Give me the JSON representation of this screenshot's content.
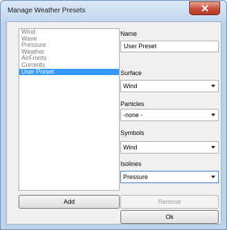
{
  "window": {
    "title": "Manage Weather Presets"
  },
  "presets": {
    "items": [
      "Wind",
      "Wave",
      "Pressure",
      "Weather",
      "AirFronts",
      "Currents",
      "User Preset"
    ],
    "selected_index": 6
  },
  "form": {
    "name_label": "Name",
    "name_value": "User Preset",
    "surface_label": "Surface",
    "surface_value": "Wind",
    "particles_label": "Particles",
    "particles_value": "-none -",
    "symbols_label": "Symbols",
    "symbols_value": "Wind",
    "isolines_label": "Isolines",
    "isolines_value": "Pressure"
  },
  "buttons": {
    "add": "Add",
    "remove": "Remove",
    "ok": "Ok"
  },
  "icons": {
    "close": "close-icon",
    "dropdown": "chevron-down-icon"
  },
  "colors": {
    "selection": "#3399ff",
    "close_button": "#c7503a"
  }
}
